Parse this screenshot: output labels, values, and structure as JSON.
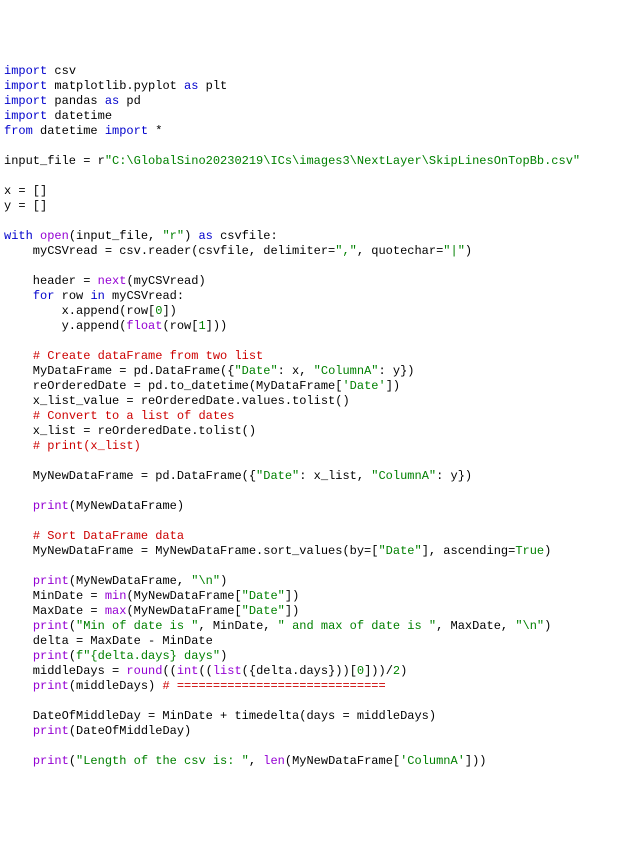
{
  "lines": [
    [
      [
        "kw",
        "import"
      ],
      [
        "",
        " csv"
      ]
    ],
    [
      [
        "kw",
        "import"
      ],
      [
        "",
        " matplotlib.pyplot "
      ],
      [
        "kw",
        "as"
      ],
      [
        "",
        " plt"
      ]
    ],
    [
      [
        "kw",
        "import"
      ],
      [
        "",
        " pandas "
      ],
      [
        "kw",
        "as"
      ],
      [
        "",
        " pd"
      ]
    ],
    [
      [
        "kw",
        "import"
      ],
      [
        "",
        " datetime"
      ]
    ],
    [
      [
        "kw",
        "from"
      ],
      [
        "",
        " datetime "
      ],
      [
        "kw",
        "import"
      ],
      [
        "",
        " *"
      ]
    ],
    [
      [
        "",
        ""
      ]
    ],
    [
      [
        "",
        "input_file = r"
      ],
      [
        "str",
        "\"C:\\GlobalSino20230219\\ICs\\images3\\NextLayer\\SkipLinesOnTopBb.csv\""
      ]
    ],
    [
      [
        "",
        ""
      ]
    ],
    [
      [
        "",
        "x = []"
      ]
    ],
    [
      [
        "",
        "y = []"
      ]
    ],
    [
      [
        "",
        ""
      ]
    ],
    [
      [
        "kw",
        "with"
      ],
      [
        "",
        " "
      ],
      [
        "fn",
        "open"
      ],
      [
        "",
        "(input_file, "
      ],
      [
        "str",
        "\"r\""
      ],
      [
        "",
        ") "
      ],
      [
        "kw",
        "as"
      ],
      [
        "",
        " csvfile:"
      ]
    ],
    [
      [
        "",
        "    myCSVread = csv.reader(csvfile, delimiter="
      ],
      [
        "str",
        "\",\""
      ],
      [
        "",
        ", quotechar="
      ],
      [
        "str",
        "\"|\""
      ],
      [
        "",
        ")"
      ]
    ],
    [
      [
        "",
        ""
      ]
    ],
    [
      [
        "",
        "    header = "
      ],
      [
        "fn",
        "next"
      ],
      [
        "",
        "(myCSVread)"
      ]
    ],
    [
      [
        "",
        "    "
      ],
      [
        "kw",
        "for"
      ],
      [
        "",
        " row "
      ],
      [
        "kw",
        "in"
      ],
      [
        "",
        " myCSVread:"
      ]
    ],
    [
      [
        "",
        "        x.append(row["
      ],
      [
        "num",
        "0"
      ],
      [
        "",
        "])"
      ]
    ],
    [
      [
        "",
        "        y.append("
      ],
      [
        "fn",
        "float"
      ],
      [
        "",
        "(row["
      ],
      [
        "num",
        "1"
      ],
      [
        "",
        "]))"
      ]
    ],
    [
      [
        "",
        ""
      ]
    ],
    [
      [
        "",
        "    "
      ],
      [
        "cmt",
        "# Create dataFrame from two list"
      ]
    ],
    [
      [
        "",
        "    MyDataFrame = pd.DataFrame({"
      ],
      [
        "str",
        "\"Date\""
      ],
      [
        "",
        ": x, "
      ],
      [
        "str",
        "\"ColumnA\""
      ],
      [
        "",
        ": y})"
      ]
    ],
    [
      [
        "",
        "    reOrderedDate = pd.to_datetime(MyDataFrame["
      ],
      [
        "str",
        "'Date'"
      ],
      [
        "",
        "])"
      ]
    ],
    [
      [
        "",
        "    x_list_value = reOrderedDate.values.tolist()"
      ]
    ],
    [
      [
        "",
        "    "
      ],
      [
        "cmt",
        "# Convert to a list of dates"
      ]
    ],
    [
      [
        "",
        "    x_list = reOrderedDate.tolist()"
      ]
    ],
    [
      [
        "",
        "    "
      ],
      [
        "cmt",
        "# print(x_list)"
      ]
    ],
    [
      [
        "",
        ""
      ]
    ],
    [
      [
        "",
        "    MyNewDataFrame = pd.DataFrame({"
      ],
      [
        "str",
        "\"Date\""
      ],
      [
        "",
        ": x_list, "
      ],
      [
        "str",
        "\"ColumnA\""
      ],
      [
        "",
        ": y})"
      ]
    ],
    [
      [
        "",
        ""
      ]
    ],
    [
      [
        "",
        "    "
      ],
      [
        "fn",
        "print"
      ],
      [
        "",
        "(MyNewDataFrame)"
      ]
    ],
    [
      [
        "",
        ""
      ]
    ],
    [
      [
        "",
        "    "
      ],
      [
        "cmt",
        "# Sort DataFrame data"
      ]
    ],
    [
      [
        "",
        "    MyNewDataFrame = MyNewDataFrame.sort_values(by=["
      ],
      [
        "str",
        "\"Date\""
      ],
      [
        "",
        "], ascending="
      ],
      [
        "num",
        "True"
      ],
      [
        "",
        ")"
      ]
    ],
    [
      [
        "",
        ""
      ]
    ],
    [
      [
        "",
        "    "
      ],
      [
        "fn",
        "print"
      ],
      [
        "",
        "(MyNewDataFrame, "
      ],
      [
        "str",
        "\"\\n\""
      ],
      [
        "",
        ")"
      ]
    ],
    [
      [
        "",
        "    MinDate = "
      ],
      [
        "fn",
        "min"
      ],
      [
        "",
        "(MyNewDataFrame["
      ],
      [
        "str",
        "\"Date\""
      ],
      [
        "",
        "])"
      ]
    ],
    [
      [
        "",
        "    MaxDate = "
      ],
      [
        "fn",
        "max"
      ],
      [
        "",
        "(MyNewDataFrame["
      ],
      [
        "str",
        "\"Date\""
      ],
      [
        "",
        "])"
      ]
    ],
    [
      [
        "",
        "    "
      ],
      [
        "fn",
        "print"
      ],
      [
        "",
        "("
      ],
      [
        "str",
        "\"Min of date is \""
      ],
      [
        "",
        ", MinDate, "
      ],
      [
        "str",
        "\" and max of date is \""
      ],
      [
        "",
        ", MaxDate, "
      ],
      [
        "str",
        "\"\\n\""
      ],
      [
        "",
        ")"
      ]
    ],
    [
      [
        "",
        "    delta = MaxDate - MinDate"
      ]
    ],
    [
      [
        "",
        "    "
      ],
      [
        "fn",
        "print"
      ],
      [
        "",
        "("
      ],
      [
        "str",
        "f\"{delta.days} days\""
      ],
      [
        "",
        ")"
      ]
    ],
    [
      [
        "",
        "    middleDays = "
      ],
      [
        "fn",
        "round"
      ],
      [
        "",
        "(("
      ],
      [
        "fn",
        "int"
      ],
      [
        "",
        "(("
      ],
      [
        "fn",
        "list"
      ],
      [
        "",
        "({delta.days}))["
      ],
      [
        "num",
        "0"
      ],
      [
        "",
        "]))/"
      ],
      [
        "num",
        "2"
      ],
      [
        "",
        ")"
      ]
    ],
    [
      [
        "",
        "    "
      ],
      [
        "fn",
        "print"
      ],
      [
        "",
        "(middleDays) "
      ],
      [
        "cmt",
        "# ============================="
      ]
    ],
    [
      [
        "",
        ""
      ]
    ],
    [
      [
        "",
        "    DateOfMiddleDay = MinDate + timedelta(days = middleDays)"
      ]
    ],
    [
      [
        "",
        "    "
      ],
      [
        "fn",
        "print"
      ],
      [
        "",
        "(DateOfMiddleDay)"
      ]
    ],
    [
      [
        "",
        ""
      ]
    ],
    [
      [
        "",
        "    "
      ],
      [
        "fn",
        "print"
      ],
      [
        "",
        "("
      ],
      [
        "str",
        "\"Length of the csv is: \""
      ],
      [
        "",
        ", "
      ],
      [
        "fn",
        "len"
      ],
      [
        "",
        "(MyNewDataFrame["
      ],
      [
        "str",
        "'ColumnA'"
      ],
      [
        "",
        "]))"
      ]
    ]
  ]
}
